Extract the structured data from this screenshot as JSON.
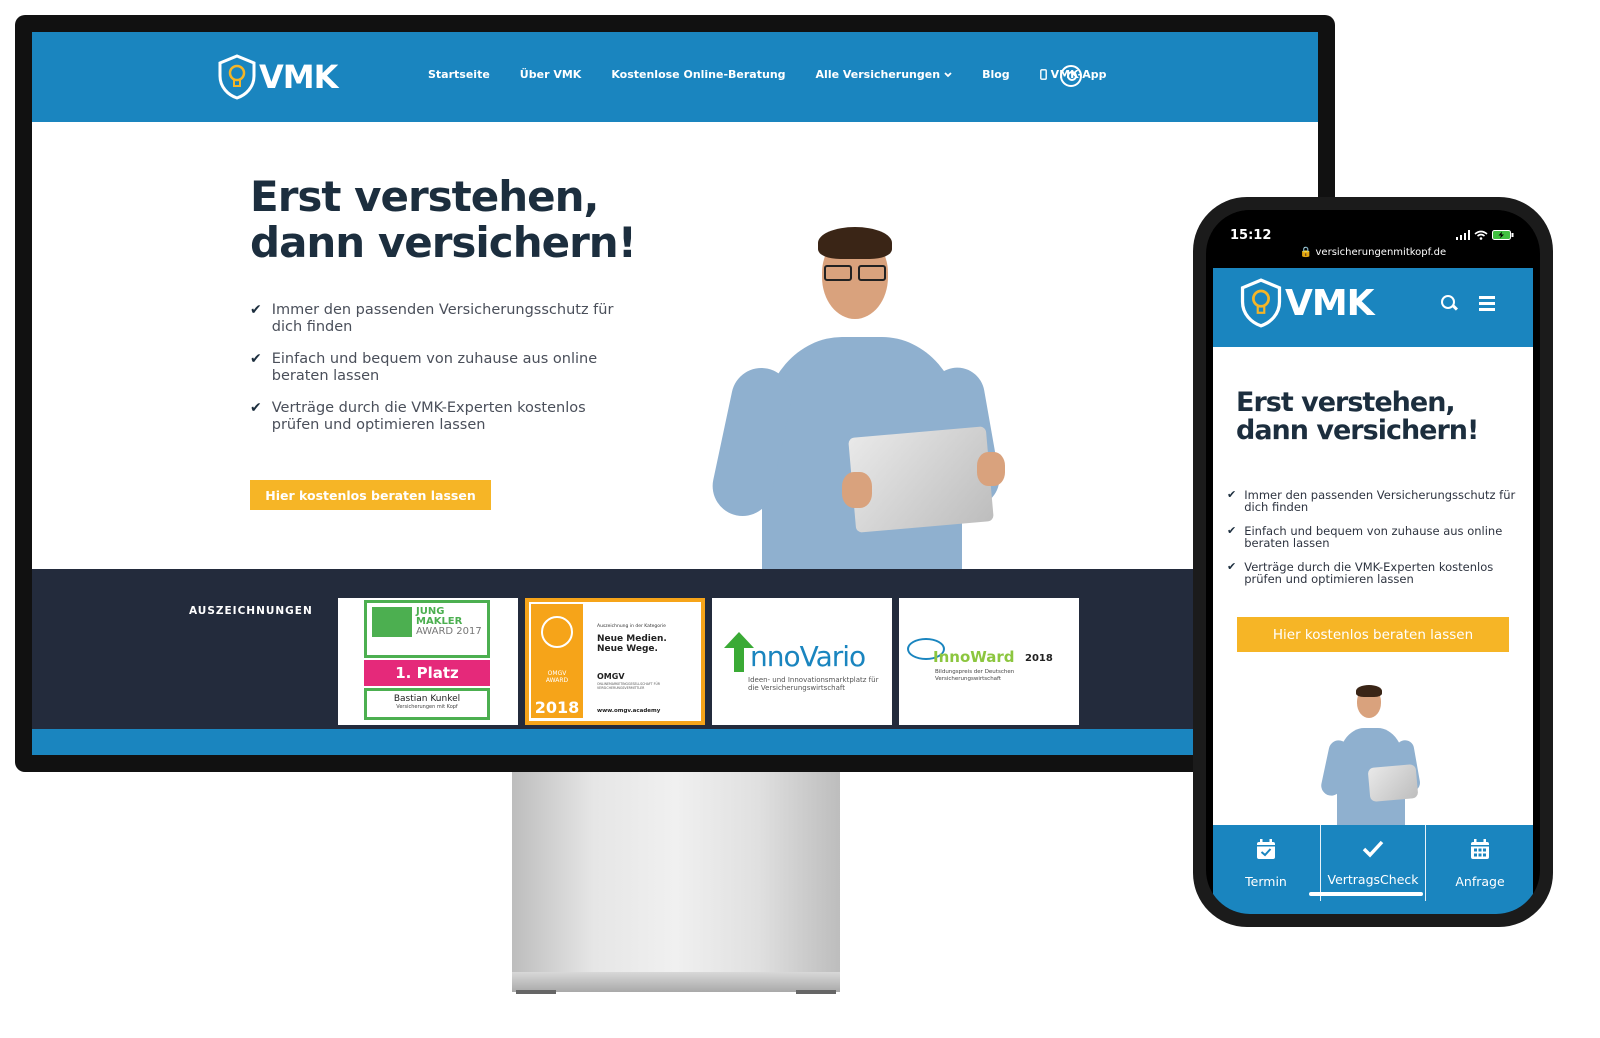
{
  "desktop": {
    "logo_text": "VMK",
    "nav": [
      {
        "label": "Startseite"
      },
      {
        "label": "Über VMK"
      },
      {
        "label": "Kostenlose Online-Beratung"
      },
      {
        "label": "Alle Versicherungen"
      },
      {
        "label": "Blog"
      },
      {
        "label": "VMK-App"
      }
    ],
    "hero": {
      "title_line1": "Erst verstehen,",
      "title_line2": "dann versichern!",
      "bullets": [
        "Immer den passenden Versicherungsschutz für dich finden",
        "Einfach und bequem von zuhause aus online beraten lassen",
        "Verträge durch die VMK-Experten kostenlos prüfen und optimieren lassen"
      ],
      "cta": "Hier kostenlos beraten lassen"
    },
    "awards": {
      "label": "AUSZEICHNUNGEN",
      "items": [
        {
          "line1": "JUNG",
          "line2": "MAKLER",
          "line3": "AWARD 2017",
          "place": "1. Platz",
          "name": "Bastian Kunkel",
          "sub": "Versicherungen mit Kopf"
        },
        {
          "badge_top": "OMGV",
          "badge_mid": "AWARD",
          "badge_year": "2018",
          "caption": "Auszeichnung in der Kategorie",
          "title_line1": "Neue Medien.",
          "title_line2": "Neue Wege.",
          "org": "OMGV",
          "org_sub": "ONLINEMARKETINGGESELLSCHAFT FÜR VERSICHERUNGSVERMITTLER",
          "url": "www.omgv.academy"
        },
        {
          "brand": "nnoVario",
          "tag": "Ideen- und Innovationsmarktplatz für die Versicherungswirtschaft"
        },
        {
          "brand": "InnoWard",
          "year": "2018",
          "tag": "Bildungspreis der Deutschen Versicherungswirtschaft"
        }
      ]
    }
  },
  "phone": {
    "time": "15:12",
    "url": "versicherungenmitkopf.de",
    "logo_text": "VMK",
    "hero": {
      "title_line1": "Erst verstehen,",
      "title_line2": "dann versichern!",
      "bullets": [
        "Immer den passenden Versicherungsschutz für dich finden",
        "Einfach und bequem von zuhause aus online beraten lassen",
        "Verträge durch die VMK-Experten kostenlos prüfen und optimieren lassen"
      ],
      "cta": "Hier kostenlos beraten lassen"
    },
    "tabs": [
      {
        "label": "Termin",
        "icon": "calendar-check-icon"
      },
      {
        "label": "VertragsCheck",
        "icon": "checkmark-icon"
      },
      {
        "label": "Anfrage",
        "icon": "calendar-grid-icon"
      }
    ]
  },
  "colors": {
    "brand_blue": "#1a85bf",
    "cta_yellow": "#f6b526",
    "dark_navy": "#232b3c",
    "title_dark": "#1c2e3e"
  }
}
